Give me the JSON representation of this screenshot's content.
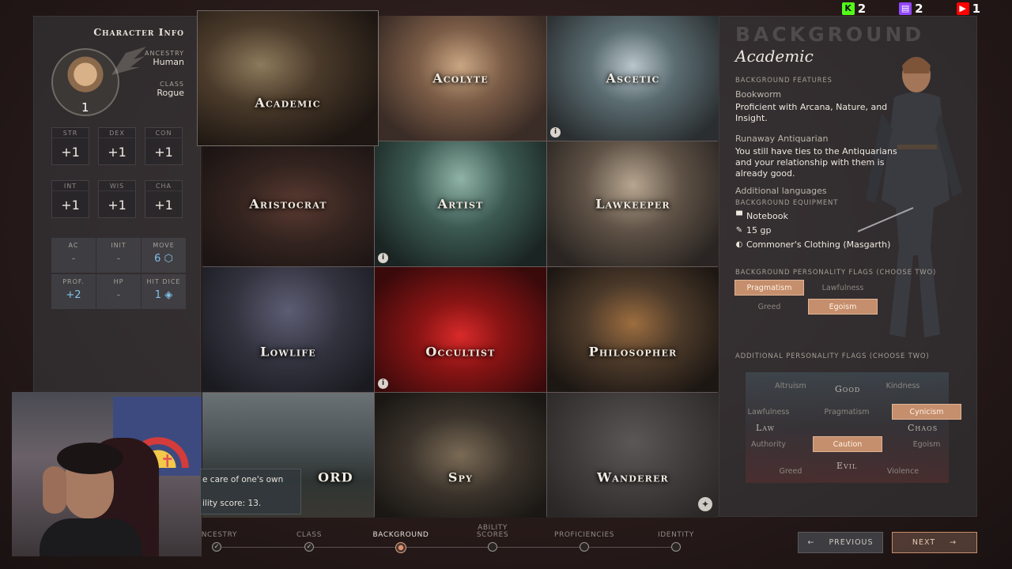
{
  "overlay": {
    "counters": [
      {
        "icon": "kick-icon",
        "value": "2",
        "color": "#53fc18"
      },
      {
        "icon": "twitch-icon",
        "value": "2",
        "color": "#9146ff"
      },
      {
        "icon": "youtube-icon",
        "value": "1",
        "color": "#ff0000"
      }
    ]
  },
  "character": {
    "title": "Character Info",
    "level": "1",
    "ancestry_label": "ANCESTRY",
    "ancestry": "Human",
    "class_label": "CLASS",
    "class": "Rogue",
    "stats": [
      {
        "key": "STR",
        "value": "+1"
      },
      {
        "key": "DEX",
        "value": "+1"
      },
      {
        "key": "CON",
        "value": "+1"
      },
      {
        "key": "INT",
        "value": "+1"
      },
      {
        "key": "WIS",
        "value": "+1"
      },
      {
        "key": "CHA",
        "value": "+1"
      }
    ],
    "derived": [
      {
        "key": "AC",
        "value": "-"
      },
      {
        "key": "INIT",
        "value": "-"
      },
      {
        "key": "MOVE",
        "value": "6"
      },
      {
        "key": "PROF.",
        "value": "+2"
      },
      {
        "key": "HP",
        "value": "-"
      },
      {
        "key": "HIT DICE",
        "value": "1"
      }
    ]
  },
  "backgrounds": {
    "academic": "Academic",
    "acolyte": "Acolyte",
    "ascetic": "Ascetic",
    "aristocrat": "Aristocrat",
    "artist": "Artist",
    "lawkeeper": "Lawkeeper",
    "lowlife": "Lowlife",
    "occultist": "Occultist",
    "philosopher": "Philosopher",
    "guard_partial": "ORD",
    "spy": "Spy",
    "wanderer": "Wanderer",
    "tooltip_line1": "e care of one's own",
    "tooltip_line2": "ility score: 13."
  },
  "detail": {
    "heading": "BACKGROUND",
    "name": "Academic",
    "features_label": "BACKGROUND FEATURES",
    "feature1_title": "Bookworm",
    "feature1_desc": "Proficient with Arcana, Nature, and Insight.",
    "feature2_title": "Runaway Antiquarian",
    "feature2_desc": "You still have ties to the Antiquarians and your relationship with them is already good.",
    "languages": "Additional languages",
    "equipment_label": "BACKGROUND EQUIPMENT",
    "equipment": [
      {
        "icon": "bag-icon",
        "label": "Notebook"
      },
      {
        "icon": "pin-icon",
        "label": "15 gp"
      },
      {
        "icon": "shield-icon",
        "label": "Commoner's Clothing (Masgarth)"
      }
    ],
    "flags_label": "BACKGROUND PERSONALITY FLAGS (CHOOSE TWO)",
    "flags": {
      "pragmatism": "Pragmatism",
      "lawfulness": "Lawfulness",
      "greed": "Greed",
      "egoism": "Egoism"
    },
    "add_flags_label": "ADDITIONAL PERSONALITY FLAGS (CHOOSE TWO)",
    "matrix": {
      "good": "Good",
      "law": "Law",
      "chaos": "Chaos",
      "evil": "Evil",
      "altruism": "Altruism",
      "kindness": "Kindness",
      "lawfulness": "Lawfulness",
      "pragmatism": "Pragmatism",
      "cynicism": "Cynicism",
      "authority": "Authority",
      "caution": "Caution",
      "egoism": "Egoism",
      "greed": "Greed",
      "violence": "Violence"
    }
  },
  "nav": {
    "steps": [
      "ANCESTRY",
      "CLASS",
      "BACKGROUND",
      "ABILITY SCORES",
      "PROFICIENCIES",
      "IDENTITY"
    ],
    "previous": "PREVIOUS",
    "next": "NEXT"
  }
}
